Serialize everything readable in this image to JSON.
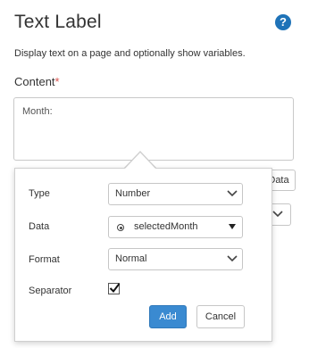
{
  "header": {
    "title": "Text Label",
    "help_icon": "?",
    "description": "Display text on a page and optionally show variables."
  },
  "content": {
    "label": "Content",
    "required_marker": "*",
    "text": "Month:"
  },
  "background": {
    "data_button_label": "Data"
  },
  "popover": {
    "type_label": "Type",
    "type_value": "Number",
    "data_label": "Data",
    "data_value": "selectedMonth",
    "format_label": "Format",
    "format_value": "Normal",
    "separator_label": "Separator",
    "separator_checked": true,
    "add_label": "Add",
    "cancel_label": "Cancel"
  },
  "colors": {
    "accent": "#3a8ad1",
    "help": "#1f73b8",
    "required": "#d9534f"
  }
}
